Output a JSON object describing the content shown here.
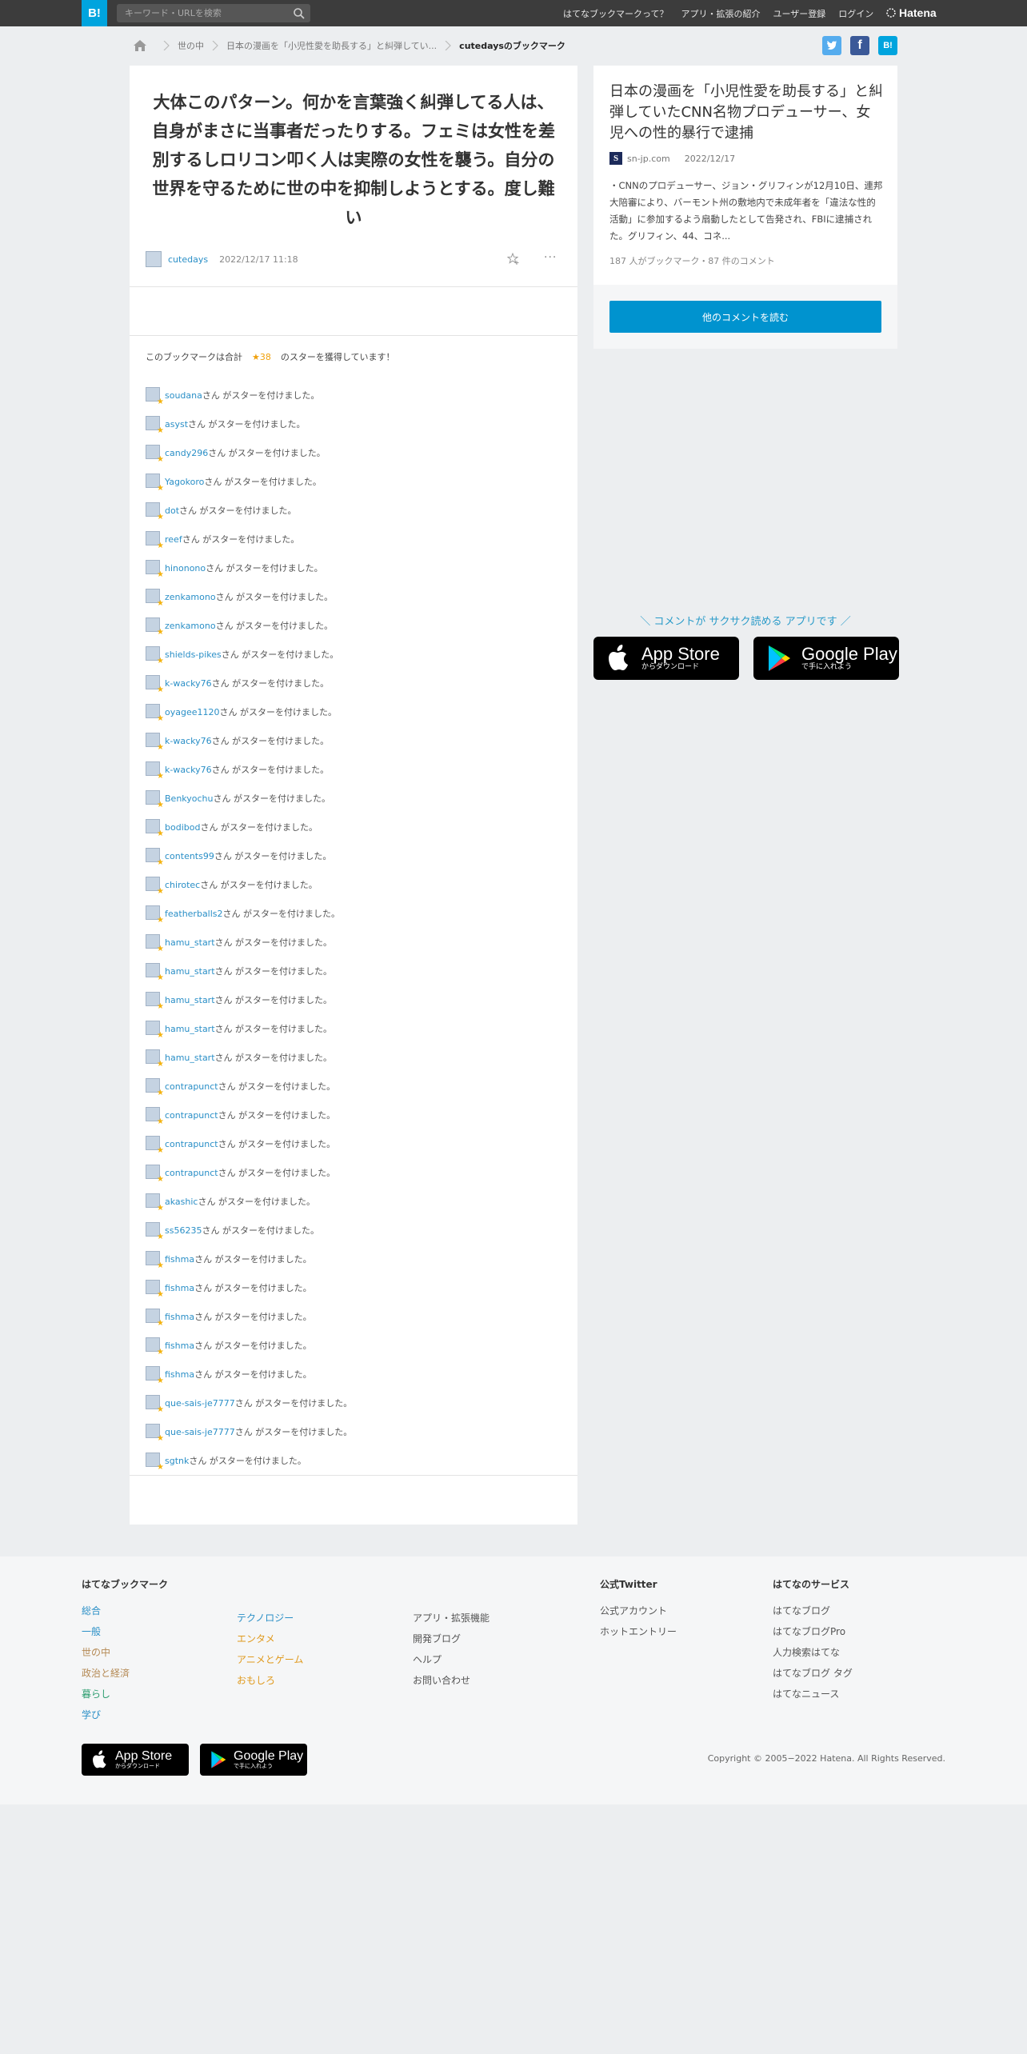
{
  "header": {
    "logo": "B!",
    "search_placeholder": "キーワード・URLを検索",
    "nav": [
      "はてなブックマークって？",
      "アプリ・拡張の紹介",
      "ユーザー登録",
      "ログイン"
    ],
    "brand": "Hatena"
  },
  "breadcrumb": {
    "items": [
      "世の中",
      "日本の漫画を「小児性愛を助長する」と糾弾してい...",
      "cutedaysのブックマーク"
    ]
  },
  "share": {
    "twitter": "t",
    "facebook": "f",
    "hatena": "B!"
  },
  "bookmark": {
    "comment": "大体このパターン。何かを言葉強く糾弾してる人は、自身がまさに当事者だったりする。フェミは女性を差別するしロリコン叩く人は実際の女性を襲う。自分の世界を守るために世の中を抑制しようとする。度し難い",
    "user": "cutedays",
    "date": "2022/12/17 11:18",
    "more": "···"
  },
  "stars": {
    "summary_prefix": "このブックマークは合計",
    "count": "★38",
    "summary_suffix": "のスターを獲得しています！",
    "suffix": "さん がスターを付けました。",
    "users": [
      "soudana",
      "asyst",
      "candy296",
      "Yagokoro",
      "dot",
      "reef",
      "hinonono",
      "zenkamono",
      "zenkamono",
      "shields-pikes",
      "k-wacky76",
      "oyagee1120",
      "k-wacky76",
      "k-wacky76",
      "Benkyochu",
      "bodibod",
      "contents99",
      "chirotec",
      "featherballs2",
      "hamu_start",
      "hamu_start",
      "hamu_start",
      "hamu_start",
      "hamu_start",
      "contrapunct",
      "contrapunct",
      "contrapunct",
      "contrapunct",
      "akashic",
      "ss56235",
      "fishma",
      "fishma",
      "fishma",
      "fishma",
      "fishma",
      "que-sais-je7777",
      "que-sais-je7777",
      "sgtnk"
    ]
  },
  "entry": {
    "title": "日本の漫画を「小児性愛を助長する」と糾弾していたCNN名物プロデューサー、女児への性的暴行で逮捕",
    "source": "sn-jp.com",
    "favicon": "S",
    "date": "2022/12/17",
    "description": "・CNNのプロデューサー、ジョン・グリフィンが12月10日、連邦大陪審により、バーモント州の敷地内で未成年者を「違法な性的活動」に参加するよう扇動したとして告発され、FBIに逮捕された。グリフィン、44、コネ...",
    "stats": "187 人がブックマーク・87 件のコメント",
    "more_button": "他のコメントを読む"
  },
  "app_promo": {
    "text": "＼ コメントが サクサク読める アプリです ／",
    "appstore_title": "App Store",
    "appstore_sub": "からダウンロード",
    "googleplay_title": "Google Play",
    "googleplay_sub": "で手に入れよう"
  },
  "footer": {
    "bookmark_heading": "はてなブックマーク",
    "categories_col1": [
      {
        "label": "総合",
        "color": "#2a8fc7"
      },
      {
        "label": "一般",
        "color": "#2a8fc7"
      },
      {
        "label": "世の中",
        "color": "#b58a55"
      },
      {
        "label": "政治と経済",
        "color": "#b58a55"
      },
      {
        "label": "暮らし",
        "color": "#2e9e70"
      },
      {
        "label": "学び",
        "color": "#2a8fc7"
      }
    ],
    "categories_col2": [
      {
        "label": "テクノロジー",
        "color": "#2a8fc7"
      },
      {
        "label": "エンタメ",
        "color": "#e09a1e"
      },
      {
        "label": "アニメとゲーム",
        "color": "#e09a1e"
      },
      {
        "label": "おもしろ",
        "color": "#e09a1e"
      }
    ],
    "links_col3": [
      "アプリ・拡張機能",
      "開発ブログ",
      "ヘルプ",
      "お問い合わせ"
    ],
    "twitter_heading": "公式Twitter",
    "twitter_links": [
      "公式アカウント",
      "ホットエントリー"
    ],
    "services_heading": "はてなのサービス",
    "services": [
      "はてなブログ",
      "はてなブログPro",
      "人力検索はてな",
      "はてなブログ タグ",
      "はてなニュース"
    ],
    "copyright": "Copyright © 2005−2022 Hatena. All Rights Reserved."
  }
}
